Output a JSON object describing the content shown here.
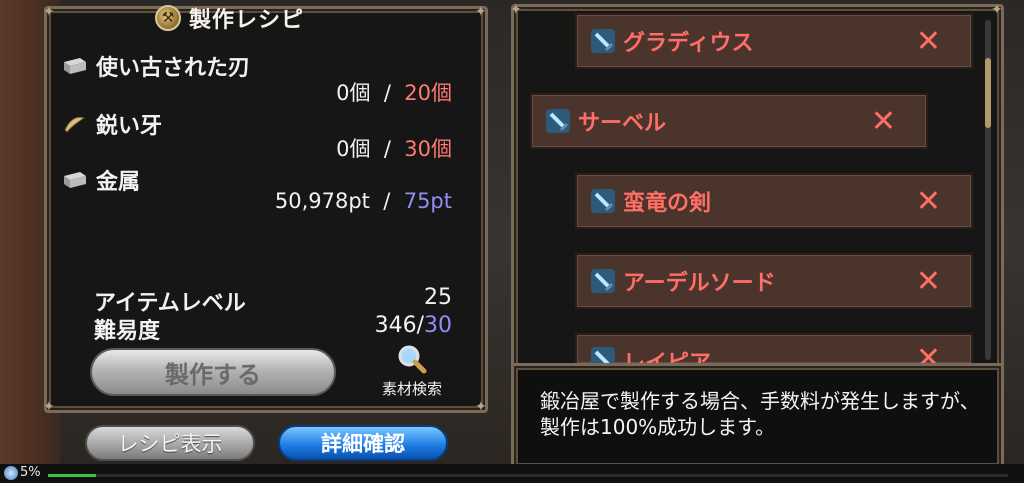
{
  "recipe": {
    "title": "製作レシピ",
    "materials": [
      {
        "name": "使い古された刃",
        "have": "0個",
        "need": "20個",
        "icon": "metal-ingot-icon"
      },
      {
        "name": "鋭い牙",
        "have": "0個",
        "need": "30個",
        "icon": "fang-icon"
      },
      {
        "name": "金属",
        "have": "50,978pt",
        "need": "75pt",
        "icon": "metal-ingot-icon"
      }
    ],
    "stats": {
      "item_level_label": "アイテムレベル",
      "item_level": "25",
      "difficulty_label": "難易度",
      "difficulty_current": "346",
      "difficulty_required": "30"
    },
    "buttons": {
      "craft": "製作する",
      "material_search": "素材検索",
      "show_recipe": "レシピ表示",
      "detail": "詳細確認"
    }
  },
  "items": [
    {
      "name": "グラディウス",
      "mark": "✕"
    },
    {
      "name": "サーベル",
      "mark": "✕"
    },
    {
      "name": "蛮竜の剣",
      "mark": "✕"
    },
    {
      "name": "アーデルソード",
      "mark": "✕"
    },
    {
      "name": "レイピア",
      "mark": "✕"
    }
  ],
  "description": "鍛冶屋で製作する場合、手数料が発生しますが、製作は100%成功します。",
  "status": {
    "progress_text": "5%",
    "progress_value": 5
  },
  "colors": {
    "missing_red": "#ff7a73",
    "points_blue": "#8f8ff7",
    "item_name_red": "#ff6f68",
    "detail_button_blue": "#1f7fe6"
  }
}
